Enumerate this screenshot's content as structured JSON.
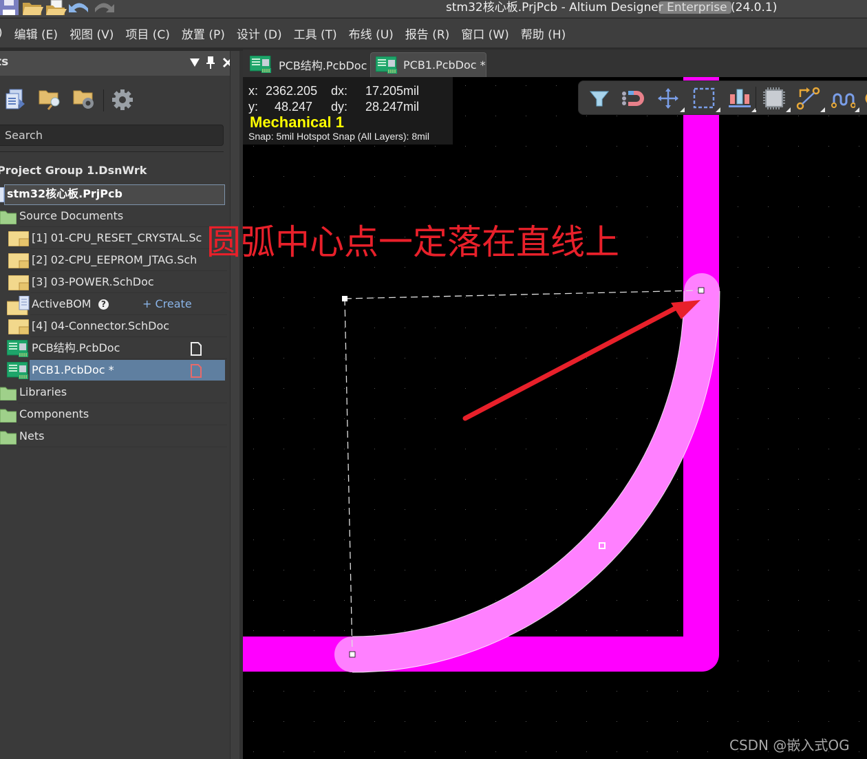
{
  "window": {
    "title": "stm32核心板.PrjPcb - Altium Designer Enterprise (24.0.1)"
  },
  "quick_access": [
    {
      "icon": "save-icon"
    },
    {
      "icon": "open-folder-icon"
    },
    {
      "icon": "open-document-icon"
    },
    {
      "icon": "undo-icon"
    },
    {
      "icon": "redo-icon"
    }
  ],
  "menu": {
    "items": [
      {
        "label": ")"
      },
      {
        "label": "编辑 (E)"
      },
      {
        "label": "视图 (V)"
      },
      {
        "label": "项目 (C)"
      },
      {
        "label": "放置 (P)"
      },
      {
        "label": "设计 (D)"
      },
      {
        "label": "工具 (T)"
      },
      {
        "label": "布线 (U)"
      },
      {
        "label": "报告 (R)"
      },
      {
        "label": "窗口 (W)"
      },
      {
        "label": "帮助 (H)"
      }
    ]
  },
  "panel": {
    "title": "ts",
    "search_placeholder": "Search",
    "toolbar_icons": [
      "project-documents-icon",
      "folder-search-icon",
      "folder-settings-icon",
      "settings-gear-icon"
    ],
    "tree": {
      "workspace": "Project Group 1.DsnWrk",
      "project": "stm32核心板.PrjPcb",
      "source_folder": "Source Documents",
      "documents": [
        {
          "label": "[1] 01-CPU_RESET_CRYSTAL.Sc",
          "type": "schematic"
        },
        {
          "label": "[2] 02-CPU_EEPROM_JTAG.Sch",
          "type": "schematic"
        },
        {
          "label": "[3] 03-POWER.SchDoc",
          "type": "schematic"
        },
        {
          "label": "ActiveBOM",
          "type": "bom",
          "action": "+ Create"
        },
        {
          "label": "[4] 04-Connector.SchDoc",
          "type": "schematic"
        },
        {
          "label": "PCB结构.PcbDoc",
          "type": "pcb",
          "status": "saved"
        },
        {
          "label": "PCB1.PcbDoc *",
          "type": "pcb",
          "status": "modified",
          "selected": true
        }
      ],
      "folders": [
        "Libraries",
        "Components",
        "Nets"
      ]
    }
  },
  "tabs": [
    {
      "label": "PCB结构.PcbDoc",
      "active": false
    },
    {
      "label": "PCB1.PcbDoc *",
      "active": true
    }
  ],
  "hud": {
    "x_label": "x:",
    "x_value": "2362.205",
    "dx_label": "dx:",
    "dx_value": "17.205mil",
    "y_label": "y:",
    "y_value": "48.247",
    "dy_label": "dy:",
    "dy_value": "28.247mil",
    "layer": "Mechanical 1",
    "snap": "Snap: 5mil Hotspot Snap (All Layers): 8mil"
  },
  "activebar": [
    {
      "icon": "filter-icon",
      "has_menu": false
    },
    {
      "icon": "snap-magnet-icon",
      "has_menu": false
    },
    {
      "icon": "move-cross-icon",
      "has_menu": true
    },
    {
      "icon": "select-rectangle-icon",
      "has_menu": true
    },
    {
      "icon": "align-icon",
      "has_menu": true
    },
    {
      "icon": "component-chip-icon",
      "has_menu": true
    },
    {
      "icon": "route-track-icon",
      "has_menu": true
    },
    {
      "icon": "interactive-length-tuning-icon",
      "has_menu": true
    }
  ],
  "annotation": "圆弧中心点一定落在直线上",
  "watermark": "CSDN @嵌入式OG",
  "colors": {
    "track": "#ff00ff",
    "arc_selected": "#ff80ff",
    "annotation": "#e8202a",
    "layer_label": "#ffff00",
    "selection_highlight": "#5f7fa0"
  }
}
